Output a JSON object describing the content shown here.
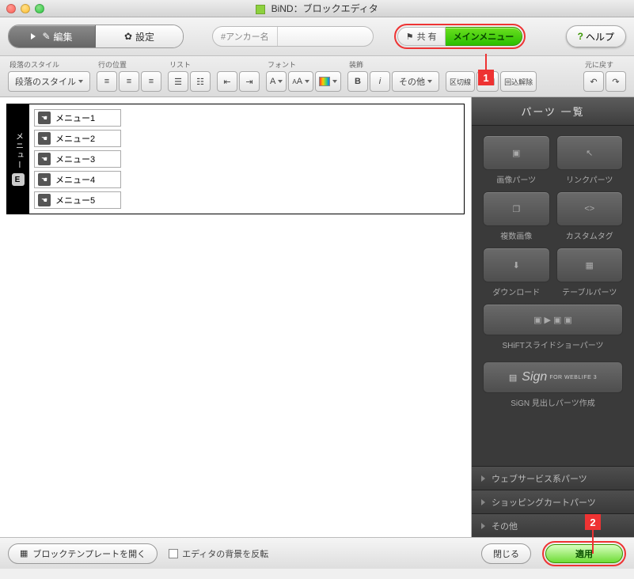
{
  "window": {
    "title": "BiND：ブロックエディタ"
  },
  "toolbar1": {
    "edit": "編集",
    "settings": "設定",
    "anchor_label": "#アンカー名",
    "anchor_value": "",
    "share": "共 有",
    "share_menu": "メインメニュー",
    "help": "ヘルプ"
  },
  "toolbar2": {
    "para_style_lbl": "段落のスタイル",
    "para_style_btn": "段落のスタイル",
    "align_lbl": "行の位置",
    "list_lbl": "リスト",
    "font_lbl": "フォント",
    "decor_lbl": "装飾",
    "other_btn": "その他",
    "undo_lbl": "元に戻す",
    "sep1": "区切線",
    "sep2": "分割",
    "sep3": "回込解除"
  },
  "canvas": {
    "tab_label": "メニュー",
    "tab_e": "E",
    "items": [
      "メニュー1",
      "メニュー2",
      "メニュー3",
      "メニュー4",
      "メニュー5"
    ]
  },
  "panel": {
    "title": "パーツ 一覧",
    "p_image": "画像パーツ",
    "p_link": "リンクパーツ",
    "p_multi": "複数画像",
    "p_custom": "カスタムタグ",
    "p_download": "ダウンロード",
    "p_table": "テーブルパーツ",
    "p_slideshow": "SHiFTスライドショーパーツ",
    "p_sign": "SiGN 見出しパーツ作成",
    "sign_brand": "Sign",
    "sign_sub": "FOR WEBLIFE 3",
    "acc1": "ウェブサービス系パーツ",
    "acc2": "ショッピングカートパーツ",
    "acc3": "その他"
  },
  "footer": {
    "template": "ブロックテンプレートを開く",
    "invert": "エディタの背景を反転",
    "close": "閉じる",
    "apply": "適用"
  },
  "callouts": {
    "n1": "1",
    "n2": "2"
  }
}
